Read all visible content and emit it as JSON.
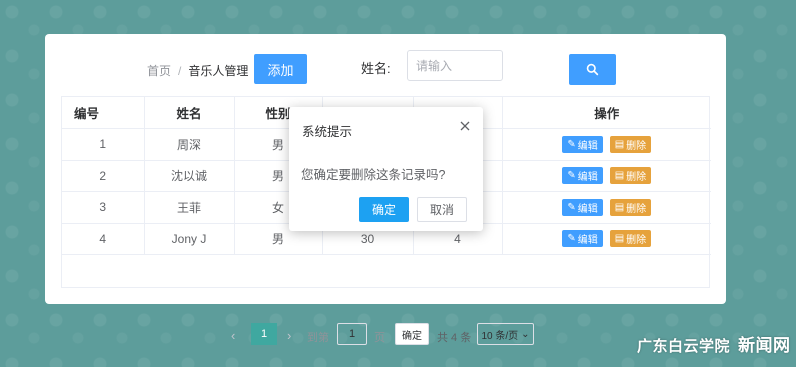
{
  "breadcrumb": {
    "home": "首页",
    "separator": "/",
    "current": "音乐人管理"
  },
  "toolbar": {
    "add_label": "添加",
    "name_label": "姓名:",
    "search_placeholder": "请输入",
    "search_icon": "search-icon"
  },
  "table": {
    "headers": [
      "编号",
      "姓名",
      "性别",
      "",
      "",
      "操作"
    ],
    "rows": [
      {
        "id": "1",
        "name": "周深",
        "gender": "男",
        "col4": "",
        "col5": ""
      },
      {
        "id": "2",
        "name": "沈以诚",
        "gender": "男",
        "col4": "",
        "col5": ""
      },
      {
        "id": "3",
        "name": "王菲",
        "gender": "女",
        "col4": "",
        "col5": ""
      },
      {
        "id": "4",
        "name": "Jony J",
        "gender": "男",
        "col4": "30",
        "col5": "4"
      }
    ],
    "edit_label": "编辑",
    "delete_label": "删除"
  },
  "pagination": {
    "current_page": "1",
    "goto_label": "到第",
    "goto_value": "1",
    "page_label": "页",
    "confirm_label": "确定",
    "total_label": "共 4 条",
    "page_size_label": "10 条/页"
  },
  "dialog": {
    "title": "系统提示",
    "message": "您确定要删除这条记录吗?",
    "ok_label": "确定",
    "cancel_label": "取消"
  },
  "watermark": {
    "text": "广东白云学院",
    "brand": "新闻网"
  },
  "colors": {
    "background": "#5d9d9b",
    "primary": "#409eff",
    "warning": "#e6a23c",
    "pager_active": "#3fa8a0",
    "dialog_ok": "#1da1f2"
  }
}
